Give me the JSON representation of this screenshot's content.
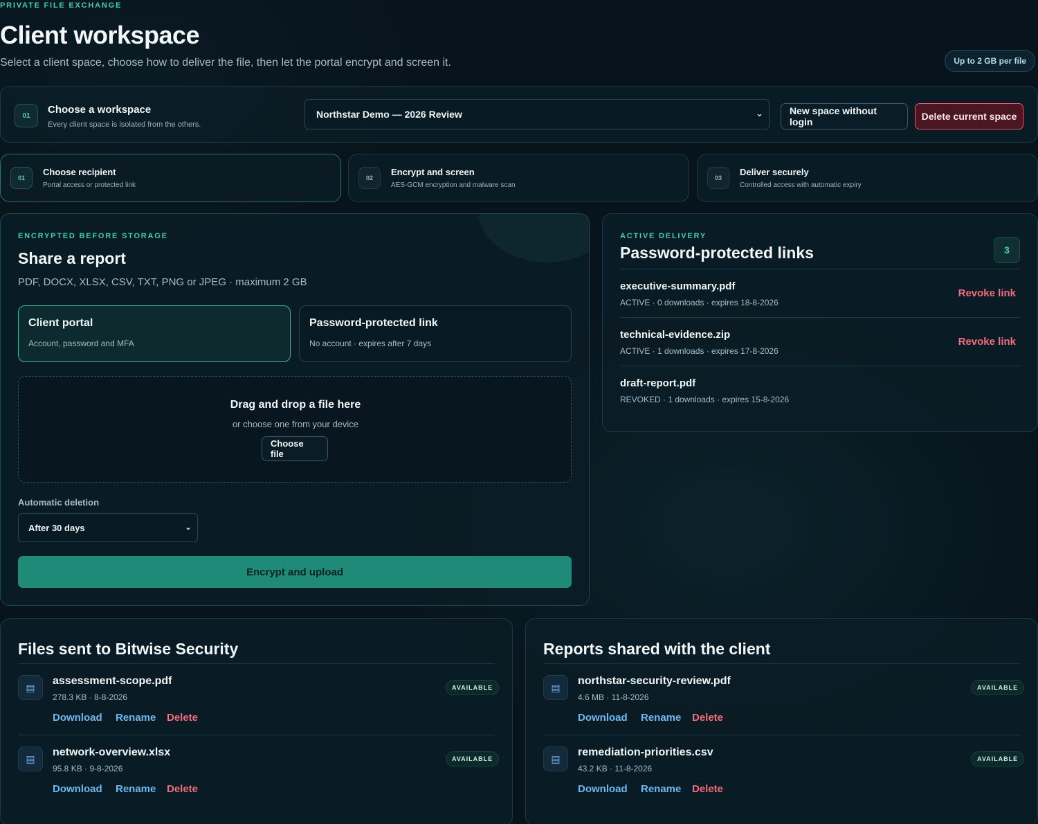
{
  "header": {
    "eyebrow": "PRIVATE FILE EXCHANGE",
    "title": "Client workspace",
    "subtitle": "Select a client space, choose how to deliver the file, then let the portal encrypt and screen it.",
    "limit_badge": "Up to 2 GB per file"
  },
  "workspace": {
    "step": "01",
    "title": "Choose a workspace",
    "description": "Every client space is isolated from the others.",
    "selected": "Northstar Demo — 2026 Review",
    "new_button": "New space without login",
    "delete_button": "Delete current space"
  },
  "steps": [
    {
      "num": "01",
      "title": "Choose recipient",
      "desc": "Portal access or protected link"
    },
    {
      "num": "02",
      "title": "Encrypt and screen",
      "desc": "AES-GCM encryption and malware scan"
    },
    {
      "num": "03",
      "title": "Deliver securely",
      "desc": "Controlled access with automatic expiry"
    }
  ],
  "share": {
    "eyebrow": "ENCRYPTED BEFORE STORAGE",
    "title": "Share a report",
    "description": "PDF, DOCX, XLSX, CSV, TXT, PNG or JPEG · maximum 2 GB",
    "modes": [
      {
        "title": "Client portal",
        "desc": "Account, password and MFA"
      },
      {
        "title": "Password-protected link",
        "desc": "No account · expires after 7 days"
      }
    ],
    "dropzone_title": "Drag and drop a file here",
    "dropzone_sub": "or choose one from your device",
    "choose_button": "Choose file",
    "deletion_label": "Automatic deletion",
    "deletion_value": "After 30 days",
    "submit_button": "Encrypt and upload"
  },
  "links": {
    "eyebrow": "ACTIVE DELIVERY",
    "title": "Password-protected links",
    "count": "3",
    "revoke_label": "Revoke link",
    "items": [
      {
        "name": "executive-summary.pdf",
        "meta": "ACTIVE · 0 downloads · expires 18-8-2026"
      },
      {
        "name": "technical-evidence.zip",
        "meta": "ACTIVE · 1 downloads · expires 17-8-2026"
      },
      {
        "name": "draft-report.pdf",
        "meta": "REVOKED · 1 downloads · expires 15-8-2026"
      }
    ]
  },
  "sent": {
    "title": "Files sent to Bitwise Security",
    "items": [
      {
        "name": "assessment-scope.pdf",
        "meta": "278.3 KB · 8-8-2026",
        "status": "AVAILABLE"
      },
      {
        "name": "network-overview.xlsx",
        "meta": "95.8 KB · 9-8-2026",
        "status": "AVAILABLE"
      }
    ]
  },
  "shared": {
    "title": "Reports shared with the client",
    "items": [
      {
        "name": "northstar-security-review.pdf",
        "meta": "4.6 MB · 11-8-2026",
        "status": "AVAILABLE"
      },
      {
        "name": "remediation-priorities.csv",
        "meta": "43.2 KB · 11-8-2026",
        "status": "AVAILABLE"
      }
    ]
  },
  "actions": {
    "download": "Download",
    "rename": "Rename",
    "delete": "Delete"
  },
  "icons": {
    "file": "file-icon",
    "chevron": "chevron-down-icon"
  }
}
